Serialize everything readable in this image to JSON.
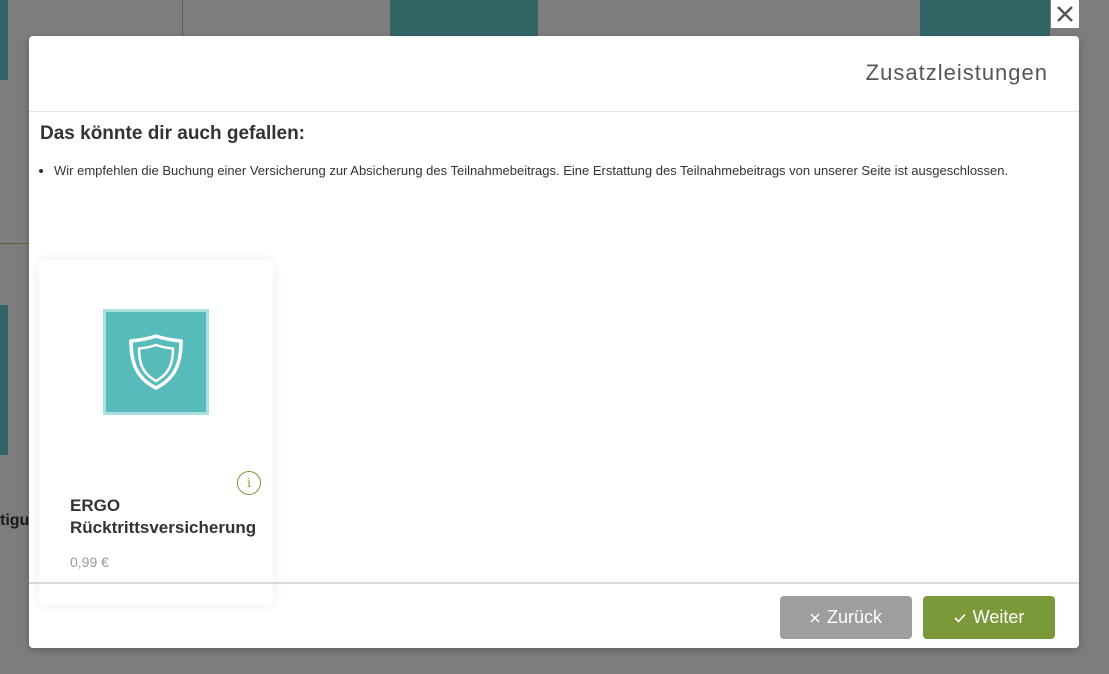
{
  "background": {
    "partial_text": "tigu"
  },
  "modal": {
    "title": "Zusatzleistungen",
    "close_icon": "close-icon",
    "section_title": "Das könnte dir auch gefallen:",
    "info_items": [
      "Wir empfehlen die Buchung einer Versicherung zur Absicherung des Teilnahmebeitrags. Eine Erstattung des Teilnahmebeitrags von unserer Seite ist ausgeschlossen."
    ],
    "products": [
      {
        "icon": "shield-icon",
        "info_label": "i",
        "name": "ERGO Rücktrittsversicherung",
        "price": "0,99 €"
      }
    ],
    "footer": {
      "back_label": "Zurück",
      "back_icon": "close-icon",
      "next_label": "Weiter",
      "next_icon": "check-icon"
    }
  },
  "colors": {
    "accent_green": "#7a9a3a",
    "button_gray": "#9e9e9e",
    "teal": "#56bbba",
    "teal_light": "#a9dfde"
  }
}
